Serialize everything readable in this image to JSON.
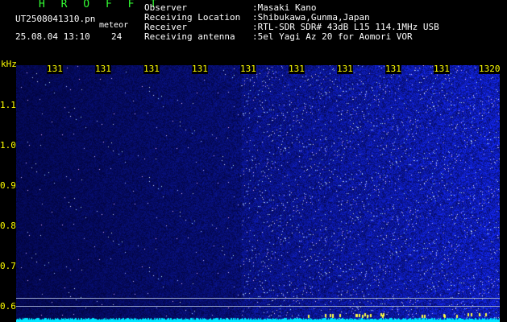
{
  "header": {
    "brand": "H R O F F T",
    "file_name": "UT2508041310.pn",
    "event_label": "meteor",
    "date_time": "25.08.04 13:10",
    "count": "24",
    "info": [
      {
        "label": "Observer",
        "value": ":Masaki Kano"
      },
      {
        "label": "Receiving Location",
        "value": ":Shibukawa,Gunma,Japan"
      },
      {
        "label": "Receiver",
        "value": ":RTL-SDR SDR# 43dB L15 114.1MHz USB"
      },
      {
        "label": "Receiving antenna",
        "value": ":5el Yagi Az 20 for Aomori VOR"
      }
    ]
  },
  "plot": {
    "y_unit": "kHz",
    "y_ticks": [
      "1.1",
      "1.0",
      "0.9",
      "0.8",
      "0.7",
      "0.6"
    ],
    "x_ticks": [
      "131",
      "131",
      "131",
      "131",
      "131",
      "131",
      "131",
      "131",
      "131",
      "1320"
    ],
    "colors": {
      "background": "#000000",
      "tick_text": "#ffff00",
      "brand": "#33ff33",
      "noise_floor": "#00e5ff"
    }
  }
}
